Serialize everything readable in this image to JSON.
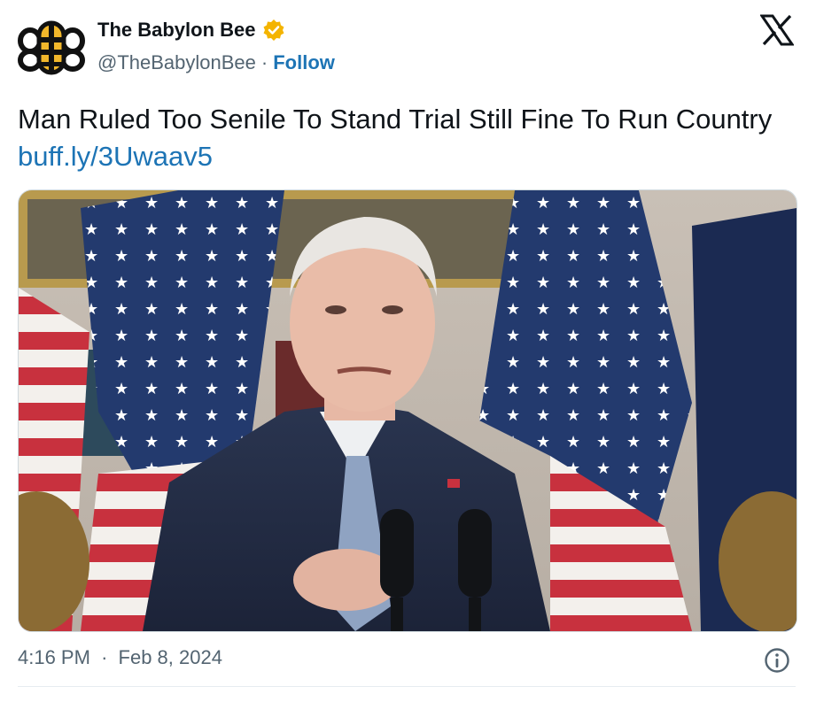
{
  "account": {
    "display_name": "The Babylon Bee",
    "handle": "@TheBabylonBee",
    "separator": "·",
    "follow_label": "Follow",
    "verified_badge_color": "#f4b400"
  },
  "tweet": {
    "text": "Man Ruled Too Senile To Stand Trial Still Fine To Run Country ",
    "link_text": "buff.ly/3Uwaav5",
    "media_icon": "photo",
    "time": "4:16 PM",
    "date_separator": "·",
    "date": "Feb 8, 2024"
  },
  "icons": {
    "logo": "bee-logo-icon",
    "verified": "verified-badge-icon",
    "platform": "x-logo-icon",
    "info": "info-icon"
  },
  "colors": {
    "link": "#1d74b5",
    "secondary_text": "#536471",
    "primary_text": "#0f1419",
    "bee_yellow": "#f2b72b"
  }
}
